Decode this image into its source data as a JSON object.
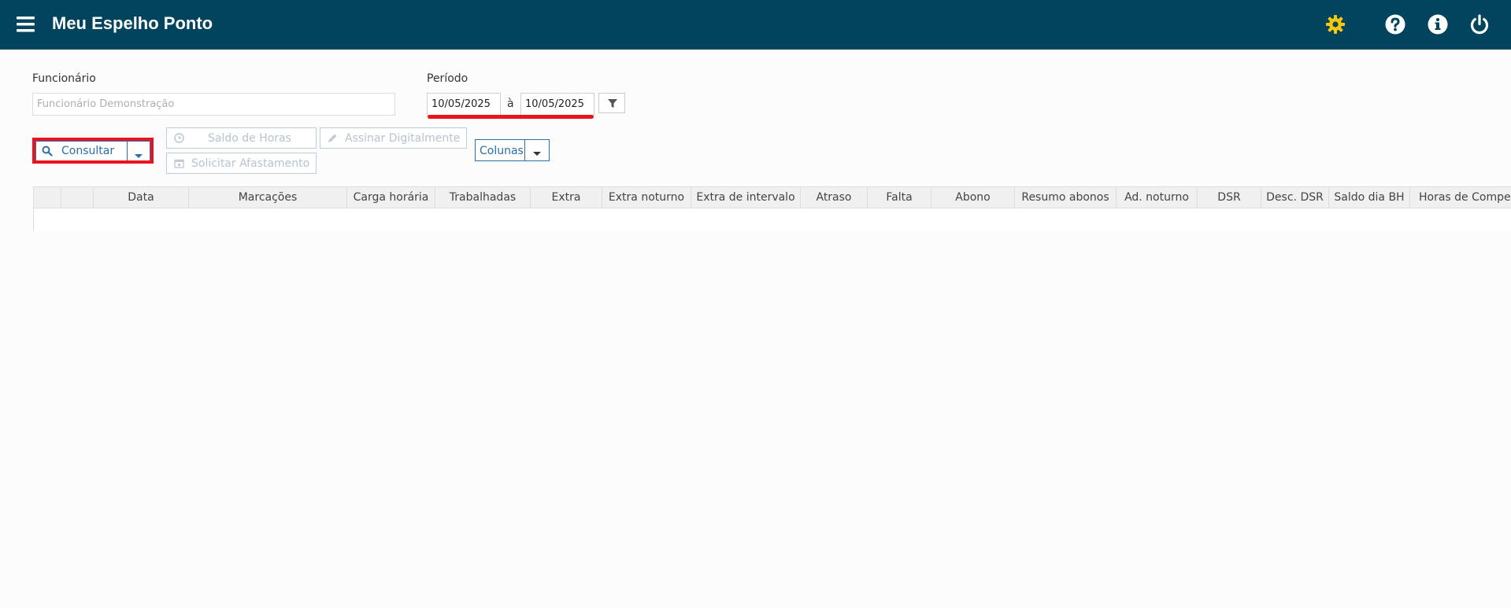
{
  "header": {
    "title": "Meu Espelho Ponto",
    "menu_icon": "hamburger-menu-icon",
    "icons": [
      "gear-icon",
      "help-icon",
      "info-icon",
      "power-icon"
    ],
    "accent_color": "#02445e",
    "gear_color": "#f6c90e"
  },
  "form": {
    "employee_label": "Funcionário",
    "employee_placeholder": "Funcionário Demonstração",
    "period_label": "Período",
    "date_start": "10/05/2025",
    "date_separator": "à",
    "date_end": "10/05/2025"
  },
  "toolbar": {
    "consultar_label": "Consultar",
    "saldo_horas_label": "Saldo de Horas",
    "assinar_label": "Assinar Digitalmente",
    "solicitar_label": "Solicitar Afastamento",
    "colunas_label": "Colunas"
  },
  "table": {
    "columns": [
      "",
      "",
      "Data",
      "Marcações",
      "Carga horária",
      "Trabalhadas",
      "Extra",
      "Extra noturno",
      "Extra de intervalo",
      "Atraso",
      "Falta",
      "Abono",
      "Resumo abonos",
      "Ad. noturno",
      "DSR",
      "Desc. DSR",
      "Saldo dia BH",
      "Horas de Compe"
    ],
    "rows": []
  }
}
